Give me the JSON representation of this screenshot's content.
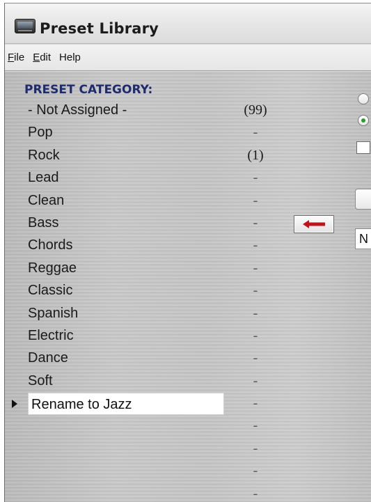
{
  "window": {
    "title": "Preset Library"
  },
  "menu": {
    "items": [
      {
        "mnemonic": "F",
        "rest": "ile"
      },
      {
        "mnemonic": "E",
        "rest": "dit"
      },
      {
        "mnemonic": "",
        "rest": "Help"
      }
    ]
  },
  "category_panel": {
    "header": "PRESET CATEGORY:",
    "rows": [
      {
        "label": "- Not Assigned -",
        "count": "(99)"
      },
      {
        "label": "Pop",
        "count": "-"
      },
      {
        "label": "Rock",
        "count": "(1)"
      },
      {
        "label": "Lead",
        "count": "-"
      },
      {
        "label": "Clean",
        "count": "-"
      },
      {
        "label": "Bass",
        "count": "-"
      },
      {
        "label": "Chords",
        "count": "-"
      },
      {
        "label": "Reggae",
        "count": "-"
      },
      {
        "label": "Classic",
        "count": "-"
      },
      {
        "label": "Spanish",
        "count": "-"
      },
      {
        "label": "Electric",
        "count": "-"
      },
      {
        "label": "Dance",
        "count": "-"
      },
      {
        "label": "Soft",
        "count": "-"
      }
    ],
    "editing_row": {
      "value": "Rename to Jazz",
      "count": "-"
    },
    "empty_rows": [
      {
        "count": "-"
      },
      {
        "count": "-"
      },
      {
        "count": "-"
      },
      {
        "count": "-"
      }
    ]
  },
  "assign_button": {
    "icon": "arrow-left-icon",
    "color": "#c0141c"
  },
  "right_panel": {
    "name_field_value": "N",
    "radio_options": [
      {
        "checked": false
      },
      {
        "checked": true
      }
    ],
    "checkbox_checked": false
  },
  "colors": {
    "header_text": "#1e2b6e",
    "radio_checked": "#2aa02a"
  }
}
